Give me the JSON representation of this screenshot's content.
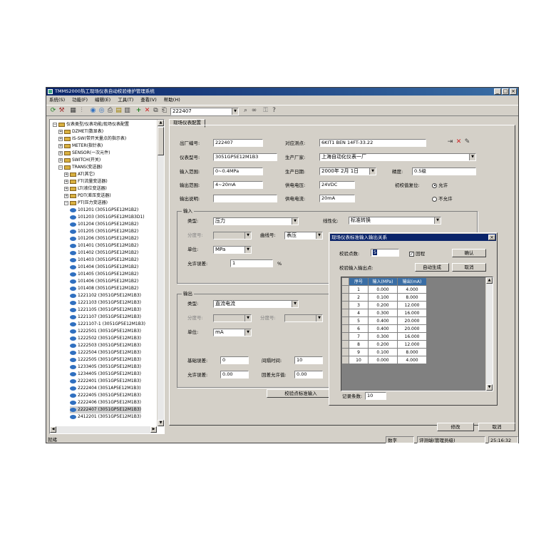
{
  "window": {
    "title": "TMMS2000热工现场仪表自动校验维护管理系统"
  },
  "menu": [
    "系统(S)",
    "功能(F)",
    "编辑(E)",
    "工具(T)",
    "查看(V)",
    "帮助(H)"
  ],
  "toolbar": {
    "combo_value": "222407",
    "icons": [
      "refresh-icon",
      "tools-icon",
      "grid-icon",
      "chart-icon",
      "eye-icon",
      "eye2-icon",
      "printer-icon",
      "report-icon",
      "table-icon",
      "add-icon",
      "delete-icon",
      "copy-icon",
      "paste-icon",
      "search-icon",
      "binoculars-icon",
      "key-icon",
      "help-icon"
    ]
  },
  "tree": {
    "items": [
      {
        "level": 0,
        "pm": "-",
        "icon": "folder",
        "label": "仪表类型/仪表功能/现场仪表配置"
      },
      {
        "level": 1,
        "pm": "+",
        "icon": "folder",
        "label": "DZMET(数显表)"
      },
      {
        "level": 1,
        "pm": "+",
        "icon": "folder",
        "label": "IS-SW(带开关量点的指示表)"
      },
      {
        "level": 1,
        "pm": "+",
        "icon": "folder",
        "label": "METER(指针表)"
      },
      {
        "level": 1,
        "pm": "+",
        "icon": "folder",
        "label": "SENSOR(一次元件)"
      },
      {
        "level": 1,
        "pm": "+",
        "icon": "folder",
        "label": "SWITCH(开关)"
      },
      {
        "level": 1,
        "pm": "-",
        "icon": "folder",
        "label": "TRANS(变送器)"
      },
      {
        "level": 2,
        "pm": "+",
        "icon": "folder",
        "label": "AT(其它)"
      },
      {
        "level": 2,
        "pm": "+",
        "icon": "folder",
        "label": "FT(流量变送器)"
      },
      {
        "level": 2,
        "pm": "+",
        "icon": "folder",
        "label": "LT(液位变送器)"
      },
      {
        "level": 2,
        "pm": "+",
        "icon": "folder",
        "label": "PDT(差压变送器)"
      },
      {
        "level": 2,
        "pm": "-",
        "icon": "folder",
        "label": "PT(压力变送器)"
      },
      {
        "level": 3,
        "pm": "",
        "icon": "eye",
        "label": "101201 (3051GP5E12M1B2)"
      },
      {
        "level": 3,
        "pm": "",
        "icon": "eye",
        "label": "101203 (3051GP5E12M1B3D1)"
      },
      {
        "level": 3,
        "pm": "",
        "icon": "eye",
        "label": "101204 (3051GP5E12M1B2)"
      },
      {
        "level": 3,
        "pm": "",
        "icon": "eye",
        "label": "101205 (3051GP5E12M1B2)"
      },
      {
        "level": 3,
        "pm": "",
        "icon": "eye",
        "label": "101206 (3051GP5E12M1B2)"
      },
      {
        "level": 3,
        "pm": "",
        "icon": "eye",
        "label": "101401 (3051GP5E12M1B2)"
      },
      {
        "level": 3,
        "pm": "",
        "icon": "eye",
        "label": "101402 (3051GP5E12M1B2)"
      },
      {
        "level": 3,
        "pm": "",
        "icon": "eye",
        "label": "101403 (3051GP5E12M1B2)"
      },
      {
        "level": 3,
        "pm": "",
        "icon": "eye",
        "label": "101404 (3051GP5E12M1B2)"
      },
      {
        "level": 3,
        "pm": "",
        "icon": "eye",
        "label": "101405 (3051GP5E12M1B2)"
      },
      {
        "level": 3,
        "pm": "",
        "icon": "eye",
        "label": "101406 (3051GP5E12M1B2)"
      },
      {
        "level": 3,
        "pm": "",
        "icon": "eye",
        "label": "101408 (3051GP5E12M1B2)"
      },
      {
        "level": 3,
        "pm": "",
        "icon": "eye",
        "label": "1221102 (3051GP5E12M1B3)"
      },
      {
        "level": 3,
        "pm": "",
        "icon": "eye",
        "label": "1221103 (3051GP5E12M1B3)"
      },
      {
        "level": 3,
        "pm": "",
        "icon": "eye",
        "label": "1221105 (3051GP5E12M1B3)"
      },
      {
        "level": 3,
        "pm": "",
        "icon": "eye",
        "label": "1221107 (3051GP5E12M1B3)"
      },
      {
        "level": 3,
        "pm": "",
        "icon": "eye",
        "label": "1221107-1 (3051GP5E12M1B3)"
      },
      {
        "level": 3,
        "pm": "",
        "icon": "eye",
        "label": "1222501 (3051GP5E12M1B3)"
      },
      {
        "level": 3,
        "pm": "",
        "icon": "eye",
        "label": "1222502 (3051GP5E12M1B3)"
      },
      {
        "level": 3,
        "pm": "",
        "icon": "eye",
        "label": "1222503 (3051GP5E12M1B3)"
      },
      {
        "level": 3,
        "pm": "",
        "icon": "eye",
        "label": "1222504 (3051GP5E12M1B3)"
      },
      {
        "level": 3,
        "pm": "",
        "icon": "eye",
        "label": "1222505 (3051GP5E12M1B3)"
      },
      {
        "level": 3,
        "pm": "",
        "icon": "eye",
        "label": "1233405 (3051GP5E12M1B3)"
      },
      {
        "level": 3,
        "pm": "",
        "icon": "eye",
        "label": "1234405 (3051GP5E12M1B3)"
      },
      {
        "level": 3,
        "pm": "",
        "icon": "eye",
        "label": "2222401 (3051GP5E12M1B3)"
      },
      {
        "level": 3,
        "pm": "",
        "icon": "eye",
        "label": "2222404 (3051AP5E12M1B3)"
      },
      {
        "level": 3,
        "pm": "",
        "icon": "eye",
        "label": "2222405 (3051GP5E12M1B3)"
      },
      {
        "level": 3,
        "pm": "",
        "icon": "eye",
        "label": "2222406 (3051GP5E12M1B3)"
      },
      {
        "level": 3,
        "pm": "",
        "icon": "eye",
        "label": "2222407 (3051GP5E12M1B3)",
        "selected": true
      },
      {
        "level": 3,
        "pm": "",
        "icon": "eye",
        "label": "2412201 (3051GP5E12M1B3)"
      }
    ]
  },
  "tab": {
    "label": "现场仪表配置"
  },
  "form": {
    "factory_no_label": "出厂编号:",
    "factory_no": "222407",
    "point_label": "对应测点:",
    "point": "6KIT1 BEN 14FT-33.22",
    "model_label": "仪表型号:",
    "model": "3051GP5E12M1B3",
    "maker_label": "生产厂家:",
    "maker": "上海自动化仪表一厂",
    "input_range_label": "输入范围:",
    "input_range": "0~0.4MPa",
    "date_label": "生产日期:",
    "date": "2000年 2月 1日",
    "accuracy_label": "精度:",
    "accuracy": "0.5级",
    "output_range_label": "输出范围:",
    "output_range": "4~20mA",
    "supply_v_label": "供电电压:",
    "supply_v": "24VDC",
    "init_reset_label": "初校值复位:",
    "allow_label": "允许",
    "disallow_label": "不允许",
    "output_desc_label": "输出说明:",
    "output_desc": "",
    "supply_i_label": "供电电流:",
    "supply_i": "20mA",
    "input_group": "输入",
    "in_type_label": "类型:",
    "in_type": "压力",
    "linear_label": "线性化:",
    "linear": "标准转换",
    "in_div_label": "分度号:",
    "in_div": "",
    "curve_label": "曲线号:",
    "curve": "表压",
    "in_unit_label": "单位:",
    "in_unit": "MPa",
    "allow_err_label": "允许误差:",
    "allow_err": "1",
    "allow_err_unit": "%",
    "output_group": "输出",
    "out_type_label": "类型:",
    "out_type": "直流电流",
    "out_div_label": "分度号:",
    "out_div": "",
    "out_div2_label": "分度号:",
    "out_div2": "",
    "out_unit_label": "单位:",
    "out_unit": "mA",
    "base_err_label": "基础误差:",
    "base_err": "0",
    "interval_label": "间隔时间:",
    "interval": "10",
    "allow_err2_label": "允许误差:",
    "allow_err2": "0.00",
    "return_err_label": "回差允许值:",
    "return_err": "0.00",
    "std_rel_button": "校验点标准输入",
    "modify_button": "修改",
    "cancel_button": "取消"
  },
  "dialog": {
    "title": "现场仪表标准输入输出关系",
    "points_label": "校验点数:",
    "points_value": "5",
    "return_label": "回程",
    "ok_button": "确认",
    "io_label": "校验输入输出点:",
    "auto_button": "自动生成",
    "cancel_button": "取消",
    "columns": [
      "序号",
      "输入(MPa)",
      "输出(mA)"
    ],
    "rows": [
      [
        "1",
        "0.000",
        "4.000"
      ],
      [
        "2",
        "0.100",
        "8.000"
      ],
      [
        "3",
        "0.200",
        "12.000"
      ],
      [
        "4",
        "0.300",
        "16.000"
      ],
      [
        "5",
        "0.400",
        "20.000"
      ],
      [
        "6",
        "0.400",
        "20.000"
      ],
      [
        "7",
        "0.300",
        "16.000"
      ],
      [
        "8",
        "0.200",
        "12.000"
      ],
      [
        "9",
        "0.100",
        "8.000"
      ],
      [
        "10",
        "0.000",
        "4.000"
      ]
    ],
    "footer_label": "记录条数:",
    "footer_value": "10"
  },
  "status": {
    "left": "就绪",
    "mode": "数字",
    "user": "评测端(管理员级)",
    "time": "25:16:32"
  }
}
